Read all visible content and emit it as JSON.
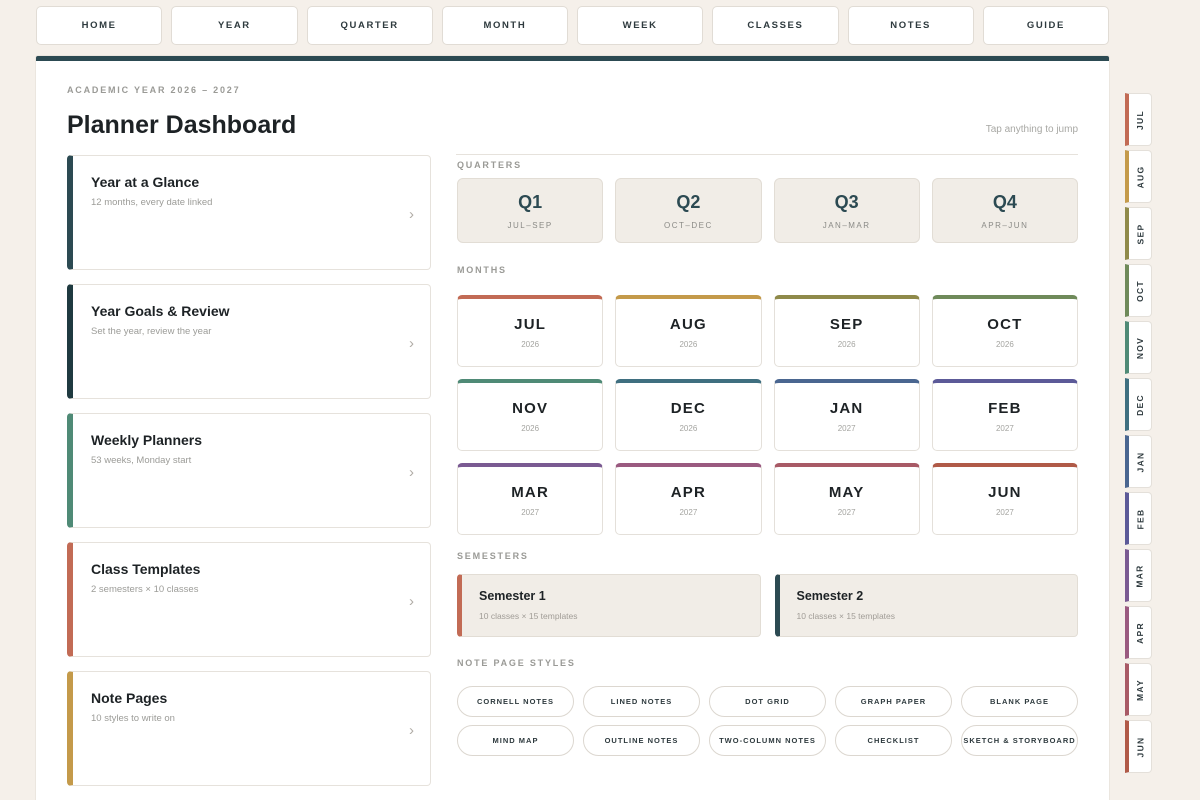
{
  "topnav": {
    "tabs": [
      {
        "label": "HOME",
        "active": true
      },
      {
        "label": "YEAR",
        "active": false
      },
      {
        "label": "QUARTER",
        "active": false
      },
      {
        "label": "MONTH",
        "active": false
      },
      {
        "label": "WEEK",
        "active": false
      },
      {
        "label": "CLASSES",
        "active": false
      },
      {
        "label": "NOTES",
        "active": false
      },
      {
        "label": "GUIDE",
        "active": false
      }
    ]
  },
  "header": {
    "eyebrow": "ACADEMIC YEAR 2026 – 2027",
    "title": "Planner Dashboard",
    "hint": "Tap anything to jump"
  },
  "cards": [
    {
      "title": "Year at a Glance",
      "subtitle": "12 months, every date linked",
      "color": "#2c4a52",
      "chevron": "›"
    },
    {
      "title": "Year Goals & Review",
      "subtitle": "Set the year, review the year",
      "color": "#1f3a40",
      "chevron": "›"
    },
    {
      "title": "Weekly Planners",
      "subtitle": "53 weeks, Monday start",
      "color": "#4f8a76",
      "chevron": "›"
    },
    {
      "title": "Class Templates",
      "subtitle": "2 semesters × 10 classes",
      "color": "#c26b55",
      "chevron": "›"
    },
    {
      "title": "Note Pages",
      "subtitle": "10 styles to write on",
      "color": "#c49a4a",
      "chevron": "›"
    }
  ],
  "sections": {
    "quarters": "QUARTERS",
    "months": "MONTHS",
    "semesters": "SEMESTERS",
    "notes": "NOTE PAGE STYLES"
  },
  "quarters": [
    {
      "name": "Q1",
      "range": "JUL–SEP"
    },
    {
      "name": "Q2",
      "range": "OCT–DEC"
    },
    {
      "name": "Q3",
      "range": "JAN–MAR"
    },
    {
      "name": "Q4",
      "range": "APR–JUN"
    }
  ],
  "months": [
    {
      "name": "JUL",
      "year": "2026",
      "color": "#c26b55"
    },
    {
      "name": "AUG",
      "year": "2026",
      "color": "#c49a4a"
    },
    {
      "name": "SEP",
      "year": "2026",
      "color": "#8f8a4a"
    },
    {
      "name": "OCT",
      "year": "2026",
      "color": "#6f8a5a"
    },
    {
      "name": "NOV",
      "year": "2026",
      "color": "#4f8a76"
    },
    {
      "name": "DEC",
      "year": "2026",
      "color": "#3f6f80"
    },
    {
      "name": "JAN",
      "year": "2027",
      "color": "#4a6690"
    },
    {
      "name": "FEB",
      "year": "2027",
      "color": "#5c5a98"
    },
    {
      "name": "MAR",
      "year": "2027",
      "color": "#7a5a92"
    },
    {
      "name": "APR",
      "year": "2027",
      "color": "#9a5a80"
    },
    {
      "name": "MAY",
      "year": "2027",
      "color": "#a85a66"
    },
    {
      "name": "JUN",
      "year": "2027",
      "color": "#b05a48"
    }
  ],
  "semesters": [
    {
      "name": "Semester 1",
      "subtitle": "10 classes × 15 templates",
      "color": "#c26b55"
    },
    {
      "name": "Semester 2",
      "subtitle": "10 classes × 15 templates",
      "color": "#2c4a52"
    }
  ],
  "note_styles": [
    "CORNELL NOTES",
    "LINED NOTES",
    "DOT GRID",
    "GRAPH PAPER",
    "BLANK PAGE",
    "MIND MAP",
    "OUTLINE NOTES",
    "TWO-COLUMN NOTES",
    "CHECKLIST",
    "SKETCH & STORYBOARD"
  ],
  "side_tabs": [
    {
      "label": "JUL",
      "color": "#c26b55"
    },
    {
      "label": "AUG",
      "color": "#c49a4a"
    },
    {
      "label": "SEP",
      "color": "#8f8a4a"
    },
    {
      "label": "OCT",
      "color": "#6f8a5a"
    },
    {
      "label": "NOV",
      "color": "#4f8a76"
    },
    {
      "label": "DEC",
      "color": "#3f6f80"
    },
    {
      "label": "JAN",
      "color": "#4a6690"
    },
    {
      "label": "FEB",
      "color": "#5c5a98"
    },
    {
      "label": "MAR",
      "color": "#7a5a92"
    },
    {
      "label": "APR",
      "color": "#9a5a80"
    },
    {
      "label": "MAY",
      "color": "#a85a66"
    },
    {
      "label": "JUN",
      "color": "#b05a48"
    }
  ]
}
